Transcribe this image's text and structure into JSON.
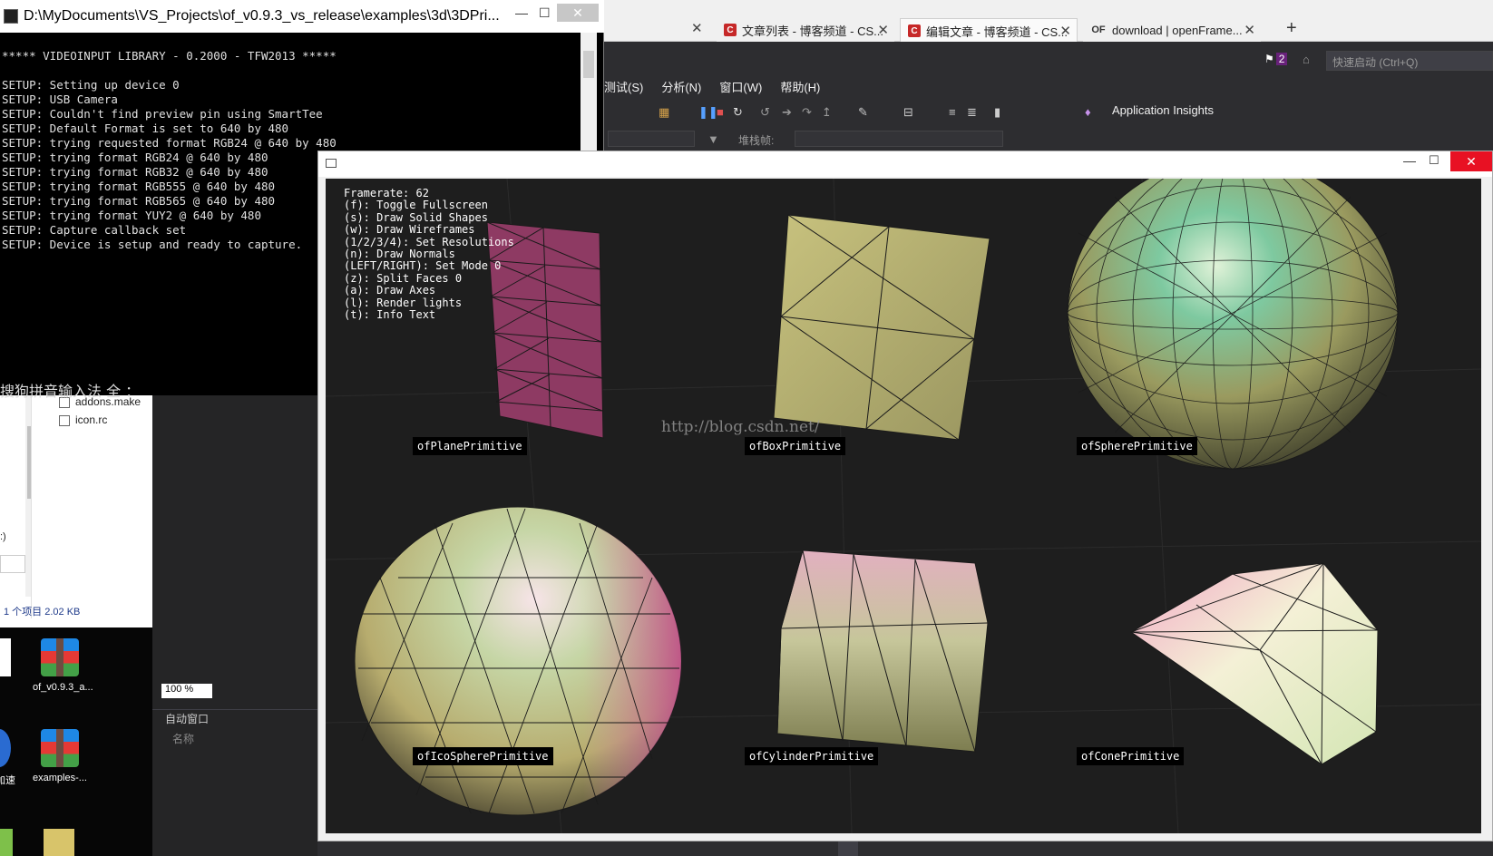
{
  "browser": {
    "tabs": [
      {
        "label": "文章列表 - 博客频道 - CS...",
        "icon": "C",
        "active": false
      },
      {
        "label": "编辑文章 - 博客频道 - CS...",
        "icon": "C",
        "active": true
      },
      {
        "label": "download | openFrame...",
        "icon": "OF",
        "active": false
      }
    ],
    "close_glyph": "✕",
    "new_tab": "+"
  },
  "vs": {
    "menu": [
      "测试(S)",
      "分析(N)",
      "窗口(W)",
      "帮助(H)"
    ],
    "notifications_count": "2",
    "quick_launch_placeholder": "快速启动 (Ctrl+Q)",
    "app_insights": "Application Insights",
    "callstack_label": "堆栈帧:",
    "zoom": "100 %",
    "auto_window_title": "自动窗口",
    "auto_window_column": "名称"
  },
  "explorer": {
    "files": [
      "addons.make",
      "icon.rc"
    ],
    "status": "1 个项目   2.02 KB",
    "drive_hint": ":)"
  },
  "desktop": {
    "icons": [
      "of_v0.9.3_a...",
      "examples-...",
      "加速"
    ]
  },
  "console": {
    "title": "D:\\MyDocuments\\VS_Projects\\of_v0.9.3_vs_release\\examples\\3d\\3DPri...",
    "min": "—",
    "max": "☐",
    "close": "✕",
    "text": "***** VIDEOINPUT LIBRARY - 0.2000 - TFW2013 *****\n\nSETUP: Setting up device 0\nSETUP: USB Camera\nSETUP: Couldn't find preview pin using SmartTee\nSETUP: Default Format is set to 640 by 480\nSETUP: trying requested format RGB24 @ 640 by 480\nSETUP: trying format RGB24 @ 640 by 480\nSETUP: trying format RGB32 @ 640 by 480\nSETUP: trying format RGB555 @ 640 by 480\nSETUP: trying format RGB565 @ 640 by 480\nSETUP: trying format YUY2 @ 640 by 480\nSETUP: Capture callback set\nSETUP: Device is setup and ready to capture.",
    "ime": "搜狗拼音输入法 全 ："
  },
  "of_window": {
    "min": "—",
    "max": "☐",
    "close": "✕",
    "info": "Framerate: 62\n(f): Toggle Fullscreen\n(s): Draw Solid Shapes\n(w): Draw Wireframes\n(1/2/3/4): Set Resolutions\n(n): Draw Normals\n(LEFT/RIGHT): Set Mode 0\n(z): Split Faces 0\n(a): Draw Axes\n(l): Render lights\n(t): Info Text",
    "watermark": "http://blog.csdn.net/",
    "labels": {
      "plane": "ofPlanePrimitive",
      "box": "ofBoxPrimitive",
      "sphere": "ofSpherePrimitive",
      "icosphere": "ofIcoSpherePrimitive",
      "cylinder": "ofCylinderPrimitive",
      "cone": "ofConePrimitive"
    },
    "colors": {
      "plane": "#8e3a63",
      "box": "#b5b06c",
      "sphere": "#9c9c6a",
      "icosphere": "#b8b07a",
      "cylinder": "#c5b88a",
      "cone": "#e8e0b0",
      "close_red": "#e81123"
    }
  }
}
